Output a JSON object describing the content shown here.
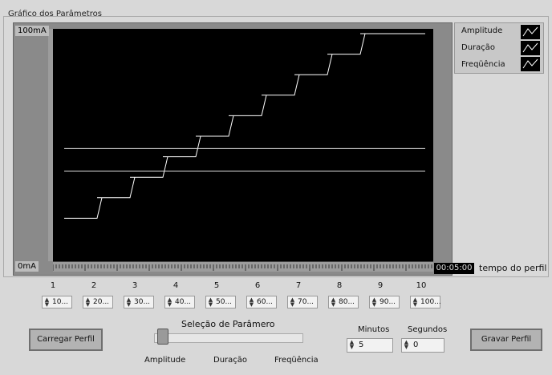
{
  "graph": {
    "title": "Gráfico dos Parâmetros",
    "y_max_label": "100mA",
    "y_min_label": "0mA",
    "time_value": "00:05:00",
    "time_label": "tempo do perfil",
    "legend": [
      {
        "label": "Amplitude"
      },
      {
        "label": "Duração"
      },
      {
        "label": "Freqüência"
      }
    ]
  },
  "chart_data": {
    "type": "line",
    "ylim": [
      0,
      100
    ],
    "series": [
      {
        "name": "Amplitude",
        "x": [
          0,
          1,
          2,
          3,
          4,
          5,
          6,
          7,
          8,
          9
        ],
        "values": [
          10,
          20,
          30,
          40,
          50,
          60,
          70,
          80,
          90,
          100
        ]
      },
      {
        "name": "Duração",
        "x": [
          0,
          9
        ],
        "values": [
          44,
          44
        ]
      },
      {
        "name": "Freqüência",
        "x": [
          0,
          9
        ],
        "values": [
          33,
          33
        ]
      }
    ]
  },
  "params": [
    {
      "num": "1",
      "value": "10..."
    },
    {
      "num": "2",
      "value": "20..."
    },
    {
      "num": "3",
      "value": "30..."
    },
    {
      "num": "4",
      "value": "40..."
    },
    {
      "num": "5",
      "value": "50..."
    },
    {
      "num": "6",
      "value": "60..."
    },
    {
      "num": "7",
      "value": "70..."
    },
    {
      "num": "8",
      "value": "80..."
    },
    {
      "num": "9",
      "value": "90..."
    },
    {
      "num": "10",
      "value": "100..."
    }
  ],
  "controls": {
    "load_button": "Carregar Perfil",
    "save_button": "Gravar Perfil",
    "selector_title": "Seleção de Parâmero",
    "selector_options": [
      "Amplitude",
      "Duração",
      "Freqüência"
    ],
    "minutes_label": "Minutos",
    "seconds_label": "Segundos",
    "minutes_value": "5",
    "seconds_value": "0"
  }
}
